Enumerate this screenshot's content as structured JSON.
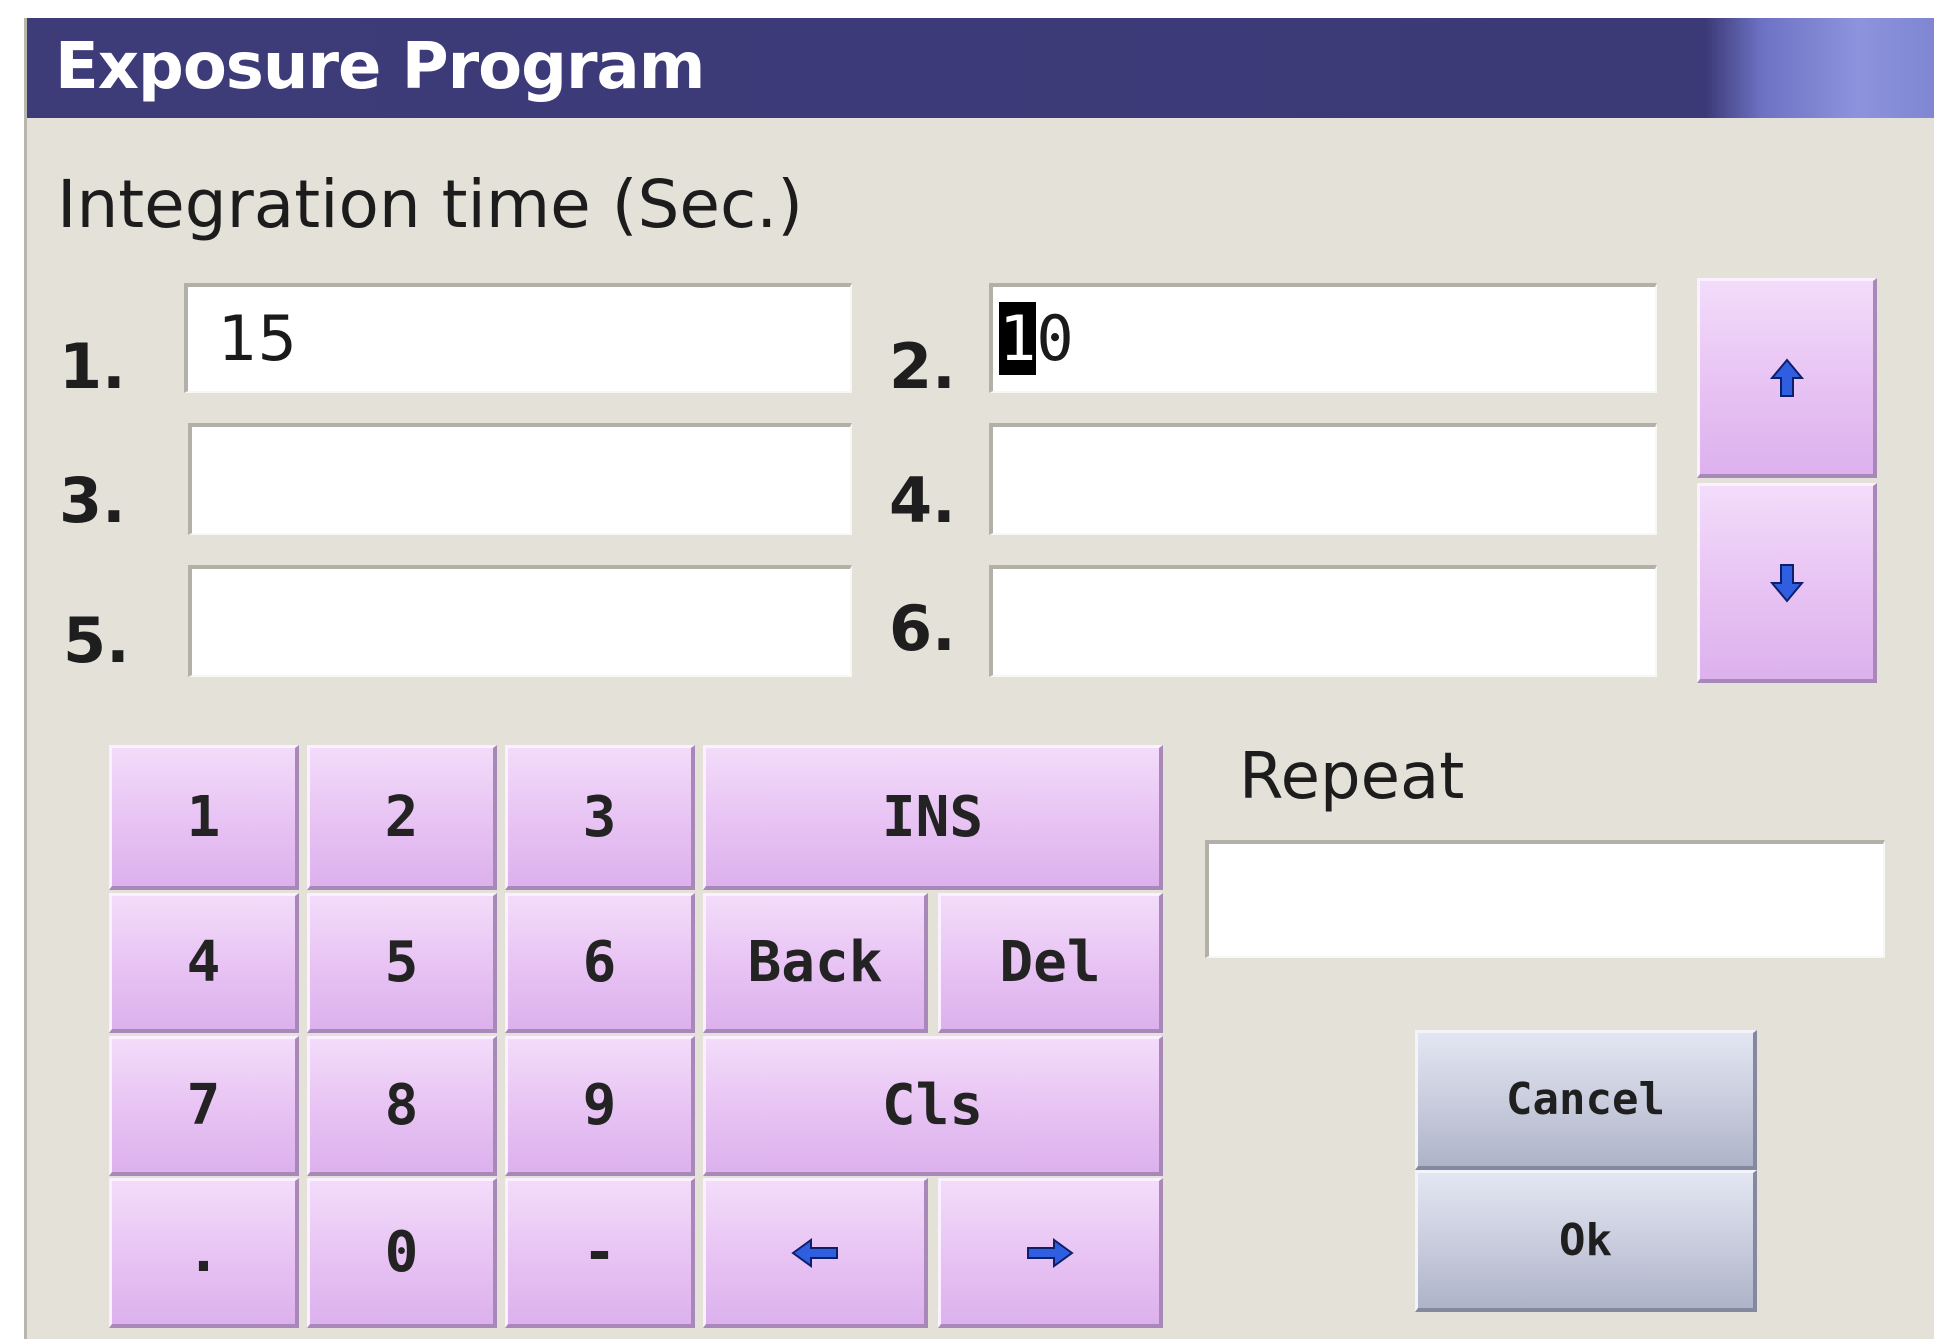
{
  "window": {
    "title": "Exposure Program"
  },
  "section": {
    "label": "Integration time (Sec.)"
  },
  "fields": [
    {
      "label": "1.",
      "value": "15"
    },
    {
      "label": "2.",
      "cursor_char": "1",
      "rest": "0"
    },
    {
      "label": "3.",
      "value": ""
    },
    {
      "label": "4.",
      "value": ""
    },
    {
      "label": "5.",
      "value": ""
    },
    {
      "label": "6.",
      "value": ""
    }
  ],
  "scroll": {
    "up_icon": "arrow-up-icon",
    "down_icon": "arrow-down-icon"
  },
  "keypad": {
    "k1": "1",
    "k2": "2",
    "k3": "3",
    "ins": "INS",
    "k4": "4",
    "k5": "5",
    "k6": "6",
    "back": "Back",
    "del": "Del",
    "k7": "7",
    "k8": "8",
    "k9": "9",
    "cls": "Cls",
    "dot": ".",
    "k0": "0",
    "minus": "-",
    "left_icon": "arrow-left-icon",
    "right_icon": "arrow-right-icon"
  },
  "repeat": {
    "label": "Repeat",
    "value": ""
  },
  "actions": {
    "cancel": "Cancel",
    "ok": "Ok"
  },
  "colors": {
    "titlebar": "#3d3b78",
    "dialog_bg": "#e4e1d9",
    "key_purple": "#e7c2f3",
    "action_grey": "#c7cbdc",
    "arrow_blue": "#2f5fe0"
  }
}
